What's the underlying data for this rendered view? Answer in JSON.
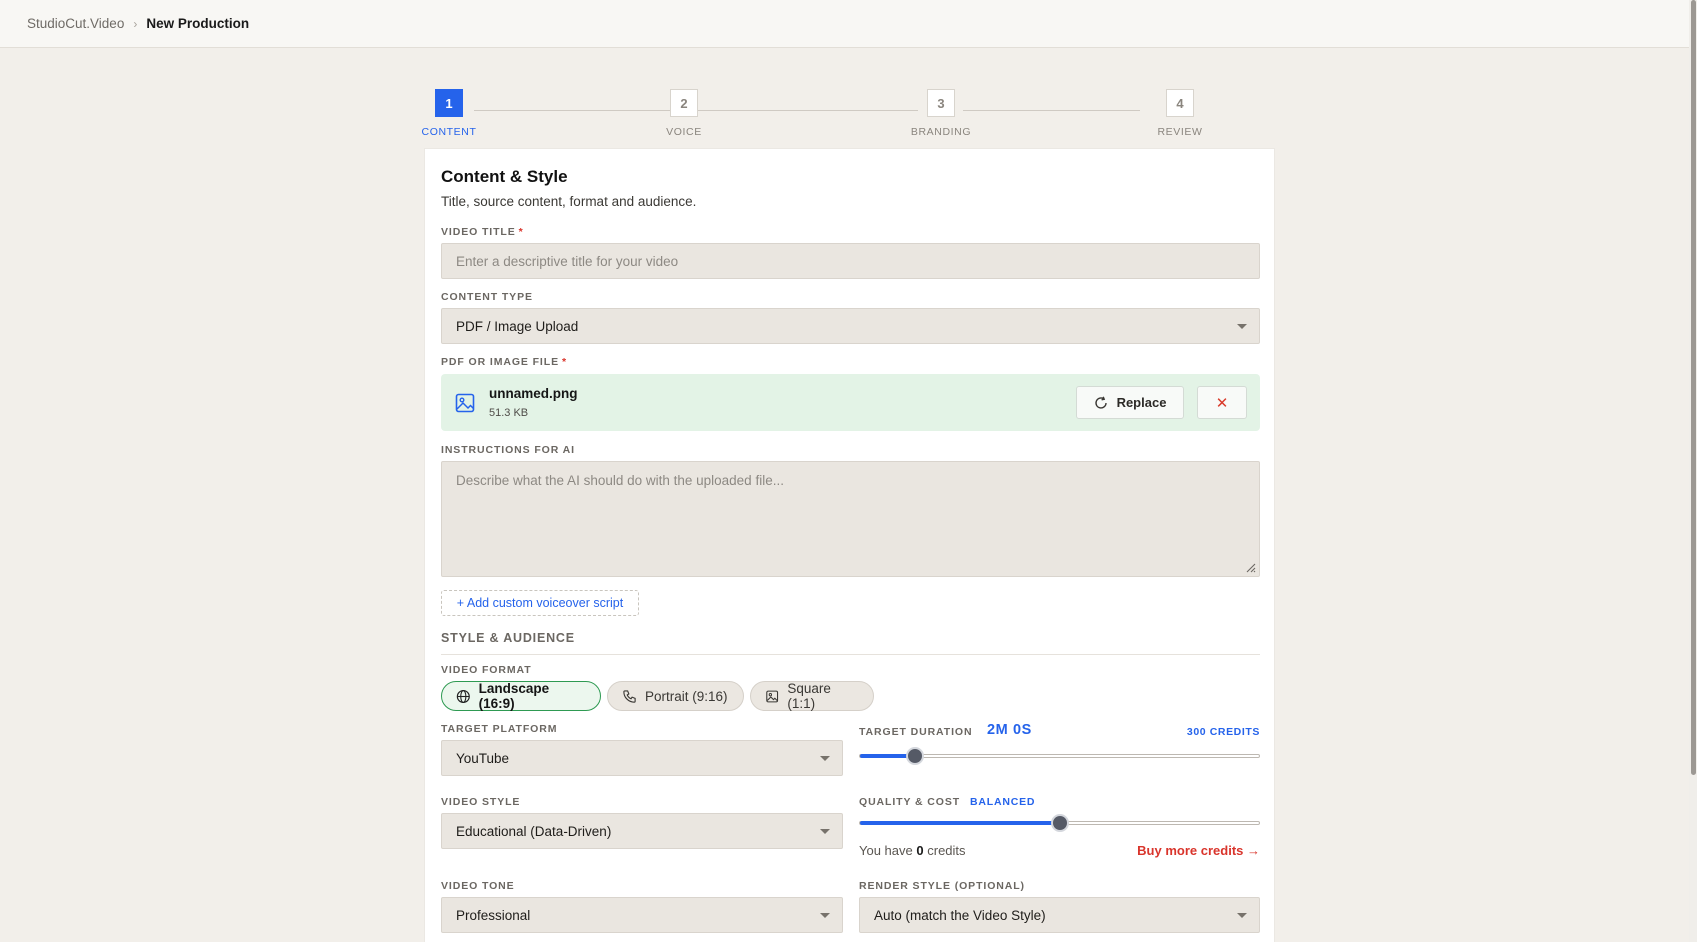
{
  "breadcrumb": {
    "root": "StudioCut.Video",
    "separator": "›",
    "current": "New Production"
  },
  "stepper": {
    "steps": [
      {
        "number": "1",
        "label": "CONTENT",
        "active": true
      },
      {
        "number": "2",
        "label": "VOICE",
        "active": false
      },
      {
        "number": "3",
        "label": "BRANDING",
        "active": false
      },
      {
        "number": "4",
        "label": "REVIEW",
        "active": false
      }
    ]
  },
  "card": {
    "title": "Content & Style",
    "subtitle": "Title, source content, format and audience."
  },
  "video_title": {
    "label": "VIDEO TITLE",
    "required_mark": "*",
    "placeholder": "Enter a descriptive title for your video",
    "value": ""
  },
  "content_type": {
    "label": "CONTENT TYPE",
    "selected": "PDF / Image Upload"
  },
  "file_upload": {
    "label": "PDF OR IMAGE FILE",
    "required_mark": "*",
    "file_name": "unnamed.png",
    "file_size": "51.3 KB",
    "replace_label": "Replace",
    "remove_label": "✕"
  },
  "instructions": {
    "label": "INSTRUCTIONS FOR AI",
    "placeholder": "Describe what the AI should do with the uploaded file..."
  },
  "add_script_label": "+ Add custom voiceover script",
  "style_section": {
    "heading": "STYLE & AUDIENCE",
    "video_format": {
      "label": "VIDEO FORMAT",
      "options": [
        {
          "label": "Landscape (16:9)",
          "icon": "globe-icon",
          "selected": true
        },
        {
          "label": "Portrait (9:16)",
          "icon": "phone-icon",
          "selected": false
        },
        {
          "label": "Square (1:1)",
          "icon": "image-icon",
          "selected": false
        }
      ]
    },
    "target_platform": {
      "label": "TARGET PLATFORM",
      "selected": "YouTube"
    },
    "target_duration": {
      "label": "TARGET DURATION",
      "value": "2M 0S",
      "credits": "300 CREDITS",
      "slider_fraction": 0.137
    },
    "video_style": {
      "label": "VIDEO STYLE",
      "selected": "Educational (Data-Driven)"
    },
    "quality_cost": {
      "label": "QUALITY & COST",
      "level": "BALANCED",
      "slider_fraction": 0.5
    },
    "credits": {
      "prefix": "You have",
      "amount": "0",
      "suffix": "credits",
      "buy_label": "Buy more credits →"
    },
    "video_tone": {
      "label": "VIDEO TONE",
      "selected": "Professional"
    },
    "render_style": {
      "label": "RENDER STYLE (OPTIONAL)",
      "selected": "Auto (match the Video Style)"
    }
  },
  "colors": {
    "accent": "#2563eb",
    "success_bg": "#e3f3e6",
    "danger": "#d9342b",
    "background": "#f2efea"
  }
}
